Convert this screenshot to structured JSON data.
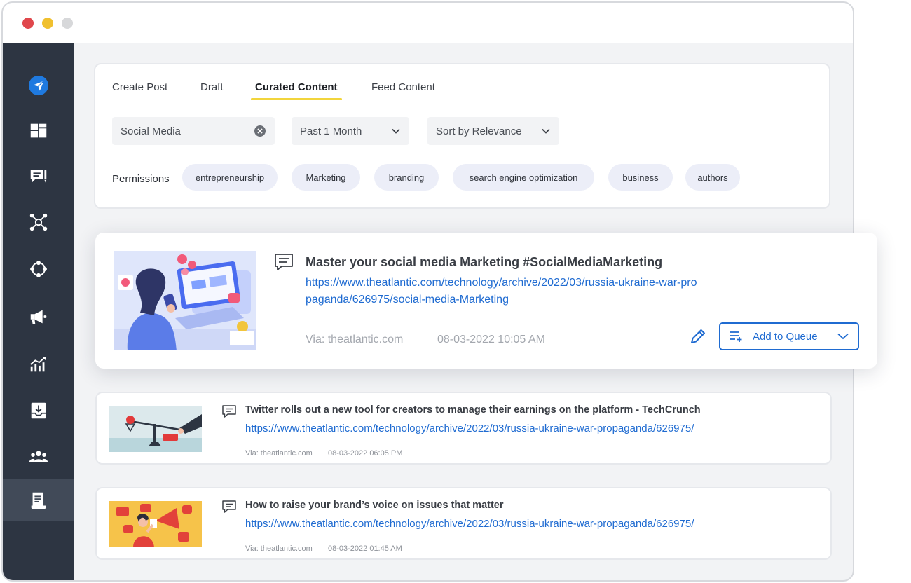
{
  "window": {
    "traffic_lights": {
      "close": "#e0474c",
      "minimize": "#f0c02f",
      "zoom": "#d7d8da"
    }
  },
  "sidebar": {
    "items": [
      {
        "icon": "send-icon"
      },
      {
        "icon": "dashboard-icon"
      },
      {
        "icon": "compose-icon"
      },
      {
        "icon": "network-icon"
      },
      {
        "icon": "circle-nodes-icon"
      },
      {
        "icon": "megaphone-icon"
      },
      {
        "icon": "analytics-icon"
      },
      {
        "icon": "inbox-download-icon"
      },
      {
        "icon": "team-icon"
      },
      {
        "icon": "document-icon",
        "active": true
      }
    ]
  },
  "tabs": [
    {
      "label": "Create Post"
    },
    {
      "label": "Draft"
    },
    {
      "label": "Curated Content",
      "active": true
    },
    {
      "label": "Feed Content"
    }
  ],
  "accent": {
    "tab_underline": "#f2d53c",
    "link": "#1f6bd1",
    "brand": "#1f7ae0"
  },
  "filters": {
    "search": {
      "value": "Social Media"
    },
    "time_range": {
      "selected": "Past 1 Month"
    },
    "sort": {
      "selected": "Sort by Relevance"
    }
  },
  "permissions": {
    "label": "Permissions",
    "chips": [
      "entrepreneurship",
      "Marketing",
      "branding",
      "search engine optimization",
      "business",
      "authors"
    ]
  },
  "featured": {
    "title": "Master your social media Marketing #SocialMediaMarketing",
    "link": "https://www.theatlantic.com/technology/archive/2022/03/russia-ukraine-war-propaganda/626975/social-media-Marketing",
    "via": "Via: theatlantic.com",
    "date": "08-03-2022 10:05 AM",
    "action_label": "Add to Queue"
  },
  "articles": [
    {
      "title": "Twitter rolls out a new tool for creators to manage their earnings on the platform - TechCrunch",
      "link": "https://www.theatlantic.com/technology/archive/2022/03/russia-ukraine-war-propaganda/626975/",
      "via": "Via: theatlantic.com",
      "date": "08-03-2022 06:05 PM"
    },
    {
      "title": "How to raise your brand’s voice on issues that matter",
      "link": "https://www.theatlantic.com/technology/archive/2022/03/russia-ukraine-war-propaganda/626975/",
      "via": "Via: theatlantic.com",
      "date": "08-03-2022 01:45 AM"
    }
  ]
}
